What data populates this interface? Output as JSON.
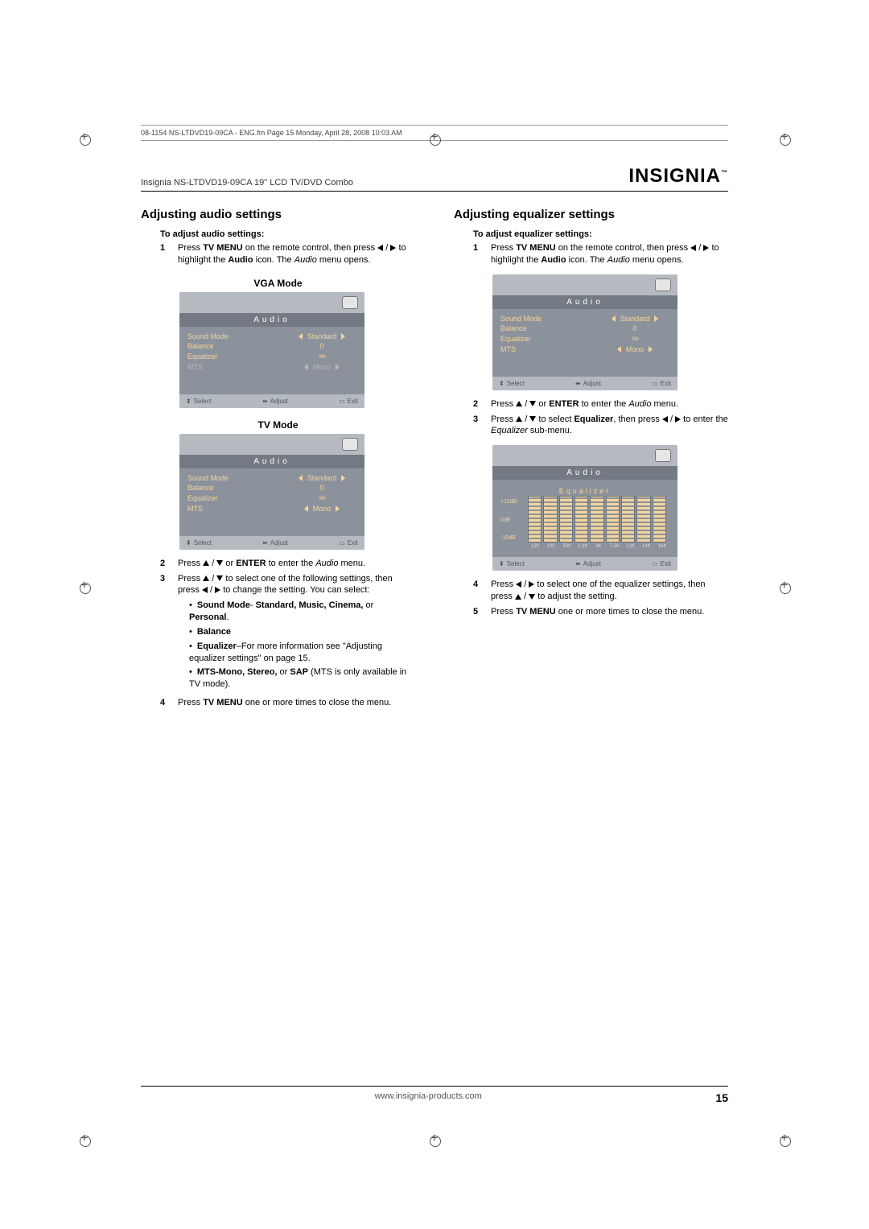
{
  "meta_line": "08-1154 NS-LTDVD19-09CA - ENG.fm  Page 15  Monday, April 28, 2008  10:03 AM",
  "product_line": "Insignia NS-LTDVD19-09CA 19\" LCD TV/DVD Combo",
  "brand": "INSIGNIA",
  "brand_tm": "™",
  "left": {
    "h2": "Adjusting audio settings",
    "sub": "To adjust audio settings:",
    "step1": {
      "n": "1",
      "pre": "Press ",
      "b1": "TV MENU",
      "mid1": " on the remote control, then press ",
      "mid2": " to highlight the ",
      "b2": "Audio",
      "mid3": " icon. The ",
      "i": "Audio",
      "end": " menu opens."
    },
    "vga_label": "VGA Mode",
    "tv_label": "TV Mode",
    "step2": {
      "n": "2",
      "pre": "Press ",
      "mid": " or ",
      "b": "ENTER",
      "mid2": " to enter the ",
      "i": "Audio",
      "end": " menu."
    },
    "step3": {
      "n": "3",
      "pre": "Press ",
      "mid1": " to select one of the following settings, then press ",
      "mid2": " to change the setting. You can select:"
    },
    "bullet_sound": {
      "b": "Sound Mode",
      "txt": "- ",
      "b2": "Standard, Music, Cinema,",
      "txt2": " or ",
      "b3": "Personal",
      "end": "."
    },
    "bullet_balance": "Balance",
    "bullet_eq": {
      "b": "Equalizer",
      "txt": "–For more information see \"Adjusting equalizer settings\" on page 15."
    },
    "bullet_mts": {
      "b": "MTS-Mono, Stereo,",
      "txt": " or ",
      "b2": "SAP",
      "txt2": " (MTS is only available in TV mode)."
    },
    "step4": {
      "n": "4",
      "pre": "Press ",
      "b": "TV MENU",
      "end": " one or more times to close the menu."
    }
  },
  "right": {
    "h2": "Adjusting equalizer settings",
    "sub": "To adjust equalizer settings:",
    "step1": {
      "n": "1",
      "pre": "Press ",
      "b1": "TV MENU",
      "mid1": " on the remote control, then press ",
      "mid2": " to highlight the ",
      "b2": "Audio",
      "mid3": " icon. The ",
      "i": "Audio",
      "end": " menu opens."
    },
    "step2": {
      "n": "2",
      "pre": "Press ",
      "mid": " or ",
      "b": "ENTER",
      "mid2": " to enter the ",
      "i": "Audio",
      "end": " menu."
    },
    "step3": {
      "n": "3",
      "pre": "Press ",
      "mid1": " to select ",
      "b": "Equalizer",
      "mid2": ", then press ",
      "mid3": " to enter the ",
      "i": "Equalizer",
      "end": " sub-menu."
    },
    "step4": {
      "n": "4",
      "pre": "Press ",
      "mid1": " to select one of the equalizer settings, then press ",
      "mid2": " to adjust the setting."
    },
    "step5": {
      "n": "5",
      "pre": "Press ",
      "b": "TV MENU",
      "end": " one or more times to close the menu."
    }
  },
  "osd": {
    "title": "Audio",
    "rows": [
      {
        "label": "Sound Mode",
        "value": "Standard",
        "arrows": true
      },
      {
        "label": "Balance",
        "value": "0"
      },
      {
        "label": "Equalizer",
        "value": "›››",
        "chev": true
      },
      {
        "label": "MTS",
        "value": "Mono",
        "arrows": true,
        "dim": true
      }
    ],
    "footer": {
      "select": "Select",
      "adjust": "Adjust",
      "exit": "Exit"
    }
  },
  "eq": {
    "title": "Audio",
    "sub": "Equalizer",
    "y": [
      "+10dB",
      "0dB",
      "-10dB"
    ],
    "x": [
      "120",
      "200",
      "500",
      "1.2K",
      "3K",
      "7.5K",
      "12K",
      "14K",
      "16K"
    ],
    "footer": {
      "select": "Select",
      "adjust": "Adjust",
      "exit": "Exit"
    }
  },
  "footer_url": "www.insignia-products.com",
  "page_num": "15"
}
